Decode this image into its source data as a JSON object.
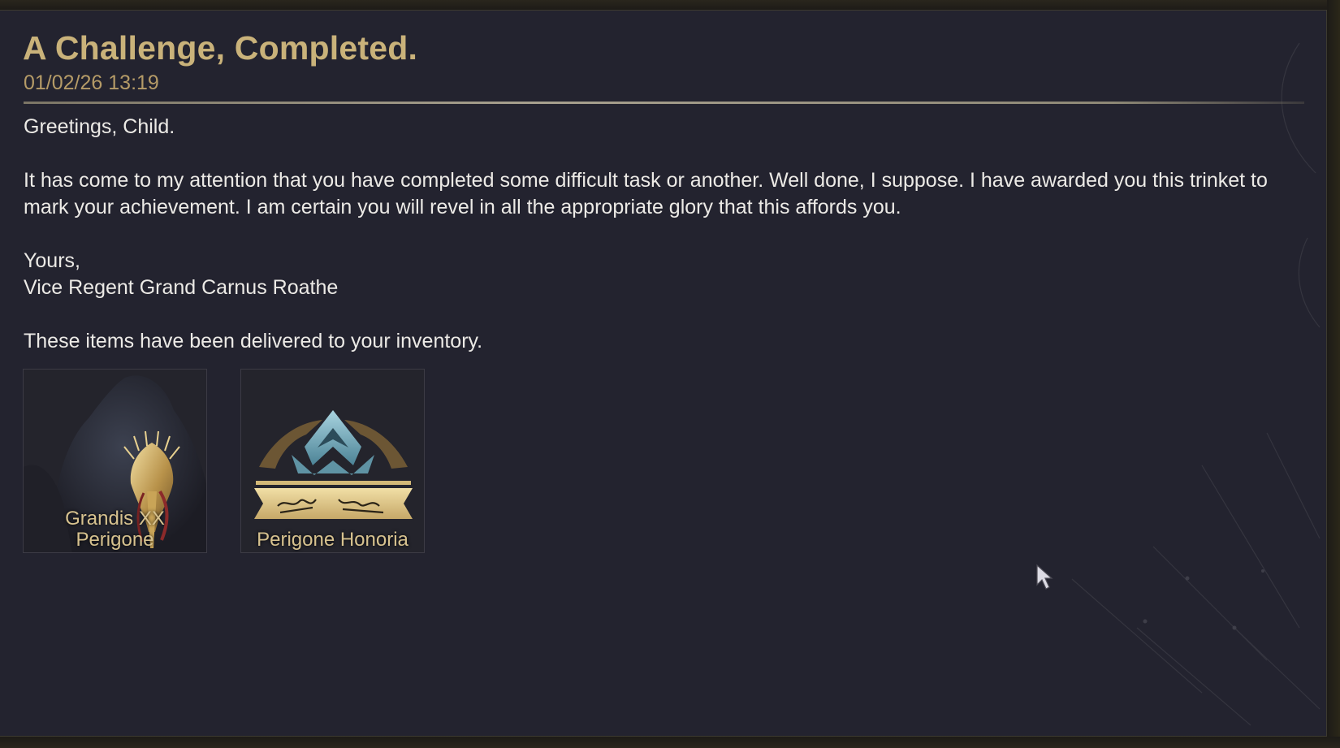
{
  "mail": {
    "title": "A Challenge, Completed.",
    "timestamp": "01/02/26 13:19",
    "greeting": "Greetings, Child.",
    "message": "It has come to my attention that you have completed some difficult task or another. Well done, I suppose. I have awarded you this trinket to mark your achievement. I am certain you will revel in all the appropriate glory that this affords you.",
    "signoff": "Yours,",
    "sender": "Vice Regent Grand Carnus Roathe",
    "delivery_note": "These items have been delivered to your inventory."
  },
  "rewards": [
    {
      "name": "Grandis XX\nPerigone",
      "icon": "ornate-gold-mask-icon"
    },
    {
      "name": "Perigone Honoria",
      "icon": "warframe-emblem-icon"
    }
  ],
  "colors": {
    "title": "#c9b27a",
    "timestamp": "#b59b67",
    "body_text": "#eceae6",
    "panel_bg": "#23232f",
    "item_label": "#d7c28f"
  }
}
